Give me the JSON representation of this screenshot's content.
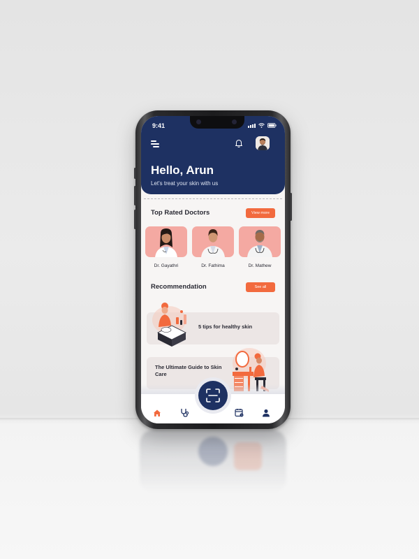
{
  "status_bar": {
    "time": "9:41"
  },
  "header": {
    "greeting": "Hello, Arun",
    "subtitle": "Let's treat your skin with us"
  },
  "top_rated": {
    "title": "Top Rated Doctors",
    "view_more_label": "View more",
    "doctors": [
      {
        "name": "Dr. Gayathri"
      },
      {
        "name": "Dr. Fathima"
      },
      {
        "name": "Dr. Mathew"
      }
    ]
  },
  "recommendation": {
    "title": "Recommendation",
    "see_all_label": "See all",
    "items": [
      {
        "title": "5 tips for healthy skin"
      },
      {
        "title": "The Ultimate Guide to Skin Care"
      }
    ]
  },
  "nav": {
    "items": [
      "home-icon",
      "stethoscope-icon",
      "scan-icon",
      "calendar-icon",
      "profile-icon"
    ],
    "active": "home-icon"
  },
  "colors": {
    "primary": "#1e3162",
    "accent": "#f26a3e",
    "card_pink": "#f4a9a2",
    "background": "#f7f5f4"
  }
}
